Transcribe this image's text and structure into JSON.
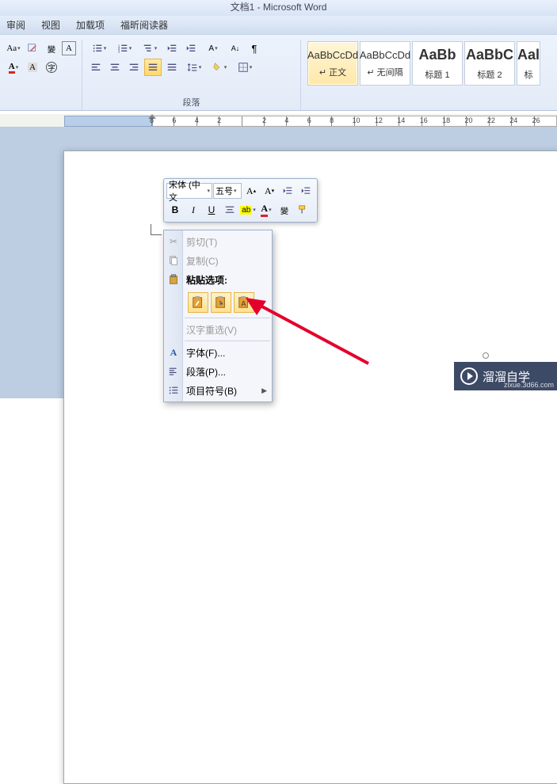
{
  "title": "文档1 - Microsoft Word",
  "menu": {
    "review": "审阅",
    "view": "视图",
    "addins": "加载项",
    "foxit": "福昕阅读器"
  },
  "ribbon": {
    "paragraph_label": "段落",
    "styles": [
      {
        "preview": "AaBbCcDd",
        "label": "↵ 正文",
        "active": true,
        "big": false
      },
      {
        "preview": "AaBbCcDd",
        "label": "↵ 无间隔",
        "active": false,
        "big": false
      },
      {
        "preview": "AaBb",
        "label": "标题 1",
        "active": false,
        "big": true
      },
      {
        "preview": "AaBbC",
        "label": "标题 2",
        "active": false,
        "big": true
      },
      {
        "preview": "Aal",
        "label": "标",
        "active": false,
        "big": true
      }
    ]
  },
  "ruler": {
    "labels": [
      "8",
      "6",
      "4",
      "2",
      "",
      "2",
      "4",
      "6",
      "8",
      "10",
      "12",
      "14",
      "16",
      "18",
      "20",
      "22",
      "24",
      "26"
    ]
  },
  "mini": {
    "font_name": "宋体 (中文",
    "font_size": "五号"
  },
  "context": {
    "cut": "剪切(T)",
    "copy": "复制(C)",
    "paste_options": "粘贴选项:",
    "reconvert": "汉字重选(V)",
    "font": "字体(F)...",
    "paragraph": "段落(P)...",
    "bullets": "项目符号(B)"
  },
  "watermark": {
    "brand": "溜溜自学",
    "url": "zixue.3d66.com"
  }
}
